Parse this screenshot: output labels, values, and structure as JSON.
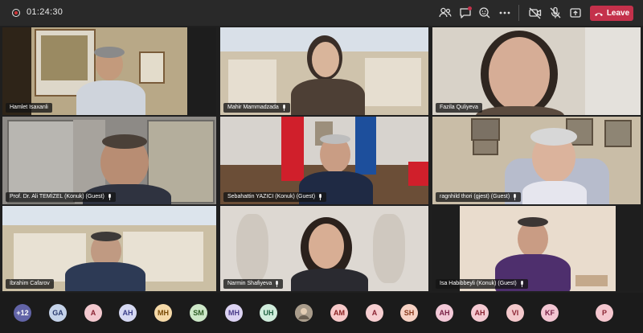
{
  "meeting": {
    "timer": "01:24:30",
    "leave_label": "Leave"
  },
  "toolbar": {
    "icons": [
      "people-icon",
      "chat-icon",
      "reactions-icon",
      "more-icon",
      "camera-off-icon",
      "mic-off-icon",
      "share-icon"
    ]
  },
  "participants": [
    {
      "name": "Hamlet Isaxanli",
      "muted": false
    },
    {
      "name": "Mahir Mammadzada",
      "muted": true
    },
    {
      "name": "Fazila Quliyeva",
      "muted": false
    },
    {
      "name": "Prof. Dr. Ali TEMİZEL (Konuk) (Guest)",
      "muted": true
    },
    {
      "name": "Sebahattin YAZICI (Konuk) (Guest)",
      "muted": true
    },
    {
      "name": "ragnhild thori (gjest) (Guest)",
      "muted": true
    },
    {
      "name": "İbrahim Cafarov",
      "muted": false
    },
    {
      "name": "Narmin Shafiyeva",
      "muted": true
    },
    {
      "name": "Isa Habibbeyli (Konuk) (Guest)",
      "muted": true
    }
  ],
  "roster": [
    {
      "label": "+12",
      "color": "#6264a7",
      "text": "#ffffff"
    },
    {
      "label": "GA",
      "color": "#c5d3ea",
      "text": "#2a3a6e"
    },
    {
      "label": "A",
      "color": "#f3c9cf",
      "text": "#8a2433"
    },
    {
      "label": "AH",
      "color": "#d6d9f3",
      "text": "#3b3f8a"
    },
    {
      "label": "MH",
      "color": "#f5d9a8",
      "text": "#7a4b06"
    },
    {
      "label": "SM",
      "color": "#cde8c8",
      "text": "#2d5c24"
    },
    {
      "label": "MH",
      "color": "#dcd3f3",
      "text": "#4a3b8a"
    },
    {
      "label": "UH",
      "color": "#d0eddc",
      "text": "#1f6140"
    },
    {
      "label": "",
      "color": "#a99c8b",
      "text": "#ffffff"
    },
    {
      "label": "AM",
      "color": "#f7c9c9",
      "text": "#8a2222"
    },
    {
      "label": "A",
      "color": "#f7cfd1",
      "text": "#8a2433"
    },
    {
      "label": "SH",
      "color": "#f7d2c4",
      "text": "#8a3b1e"
    },
    {
      "label": "AH",
      "color": "#f3c9d8",
      "text": "#7a2247"
    },
    {
      "label": "AH",
      "color": "#f5cad2",
      "text": "#8a2433"
    },
    {
      "label": "VI",
      "color": "#f4c9cc",
      "text": "#8a2433"
    },
    {
      "label": "KF",
      "color": "#f3c6d3",
      "text": "#7a2247"
    },
    {
      "label": "P",
      "color": "#f5c7cf",
      "text": "#8a2433"
    }
  ]
}
